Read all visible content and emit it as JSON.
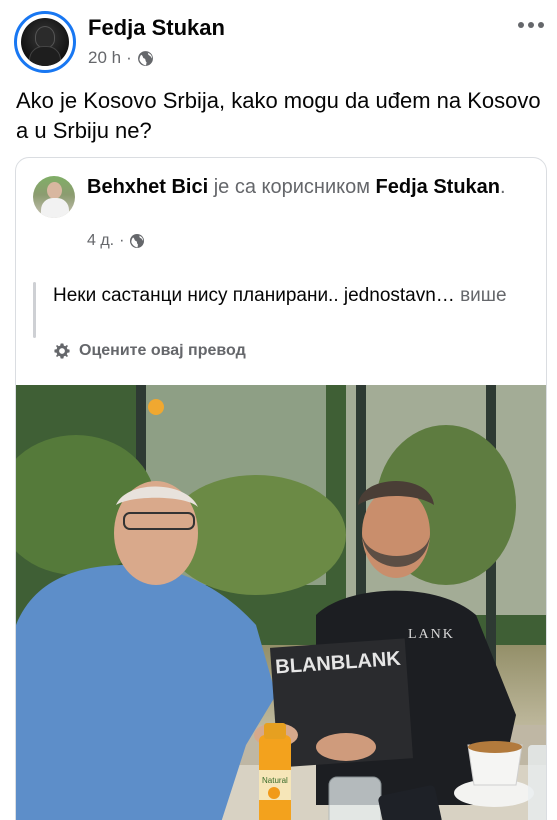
{
  "post": {
    "author": "Fedja Stukan",
    "time": "20 h",
    "separator": "·",
    "text": "Ako je Kosovo Srbija, kako mogu da uđem na Kosovo a u Srbiju ne?",
    "more_icon": "more-horizontal-icon",
    "privacy_icon": "globe-icon"
  },
  "shared": {
    "author": "Behxhet Bici",
    "with_text": "је са корисником",
    "tagged": "Fedja Stukan",
    "period": ".",
    "time": "4 д.",
    "separator": "·",
    "text": "Неки састанци нису планирани.. jednostavn…",
    "see_more": "више",
    "translate": "Оцените овај превод",
    "translate_icon": "gear-icon",
    "photo": {
      "book_text": "BLANBLANK",
      "shirt_text": "LANK",
      "bottle_text": "Natural"
    }
  },
  "colors": {
    "accent": "#1877f2",
    "secondary_text": "#65676b",
    "primary_text": "#050505",
    "border": "#dadde1"
  }
}
